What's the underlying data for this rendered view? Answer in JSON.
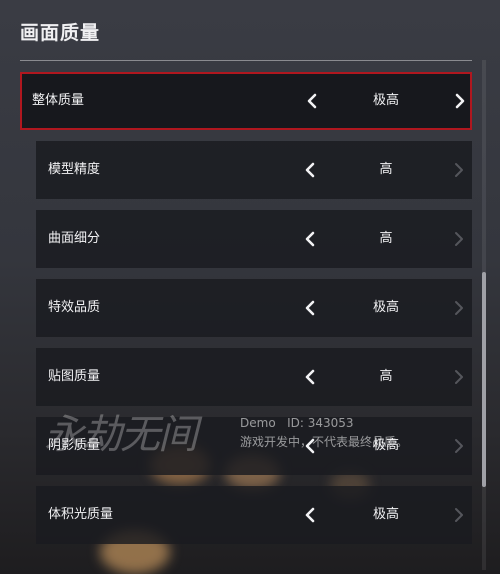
{
  "section": {
    "title": "画面质量"
  },
  "master": {
    "label": "整体质量",
    "value": "极高"
  },
  "settings": [
    {
      "label": "模型精度",
      "value": "高"
    },
    {
      "label": "曲面细分",
      "value": "高"
    },
    {
      "label": "特效品质",
      "value": "极高"
    },
    {
      "label": "贴图质量",
      "value": "高"
    },
    {
      "label": "阴影质量",
      "value": "极高"
    },
    {
      "label": "体积光质量",
      "value": "极高"
    }
  ],
  "watermark": {
    "logo": "永劫无间",
    "line1": "Demo   ID: 343053",
    "line2": "游戏开发中，不代表最终品质。"
  },
  "colors": {
    "accent_border": "#b0171f",
    "row_bg": "#1a1b20",
    "text": "#f2f2f4",
    "disabled_arrow": "#55565c"
  },
  "icons": {
    "left": "chevron-left-icon",
    "right": "chevron-right-icon"
  }
}
